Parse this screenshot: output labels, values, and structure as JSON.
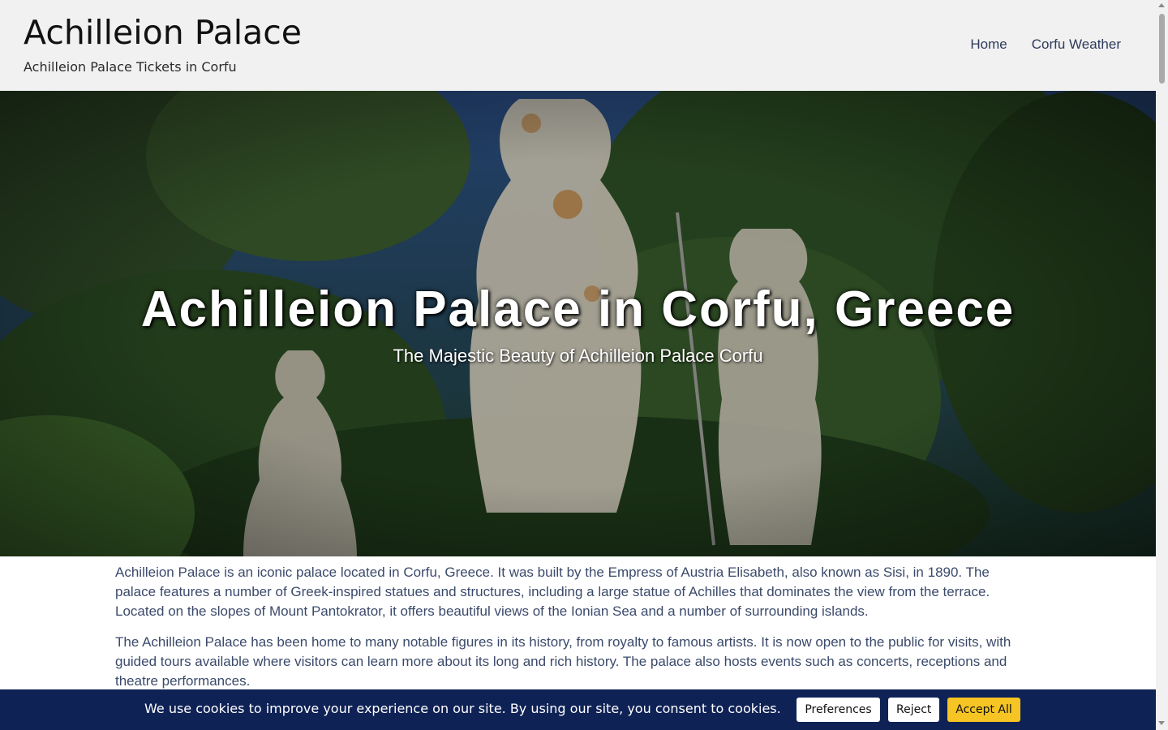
{
  "header": {
    "site_title": "Achilleion Palace",
    "tagline": "Achilleion Palace Tickets in Corfu",
    "nav": [
      {
        "label": "Home"
      },
      {
        "label": "Corfu Weather"
      }
    ]
  },
  "hero": {
    "title": "Achilleion Palace in Corfu, Greece",
    "subtitle": "The Majestic Beauty of Achilleion Palace Corfu"
  },
  "content": {
    "paragraphs": [
      "Achilleion Palace is an iconic palace located in Corfu, Greece. It was built by the Empress of Austria Elisabeth, also known as Sisi, in 1890. The palace features a number of Greek-inspired statues and structures, including a large statue of Achilles that dominates the view from the terrace. Located on the slopes of Mount Pantokrator, it offers beautiful views of the Ionian Sea and a number of surrounding islands.",
      "The Achilleion Palace has been home to many notable figures in its history, from royalty to famous artists. It is now open to the public for visits, with guided tours available where visitors can learn more about its long and rich history. The palace also hosts events such as concerts, receptions and theatre performances."
    ]
  },
  "cookie_bar": {
    "message": "We use cookies to improve your experience on our site. By using our site, you consent to cookies.",
    "preferences_label": "Preferences",
    "reject_label": "Reject",
    "accept_label": "Accept All"
  },
  "colors": {
    "header_bg": "#f1f1f1",
    "nav_link": "#2e3a5c",
    "body_text": "#3b4a6b",
    "cookie_bg": "#0f2256",
    "accept_button": "#f6c523"
  }
}
